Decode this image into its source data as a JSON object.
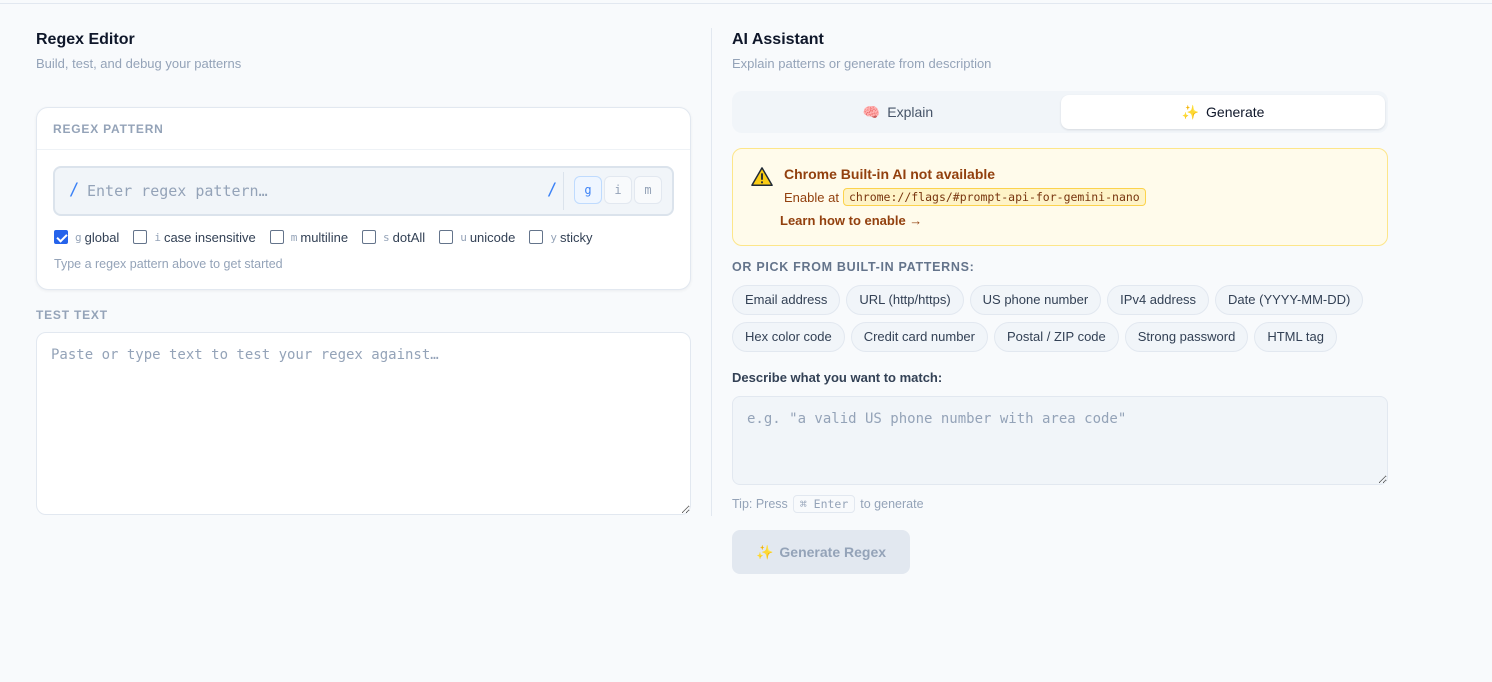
{
  "editor": {
    "title": "Regex Editor",
    "subtitle": "Build, test, and debug your patterns",
    "pattern_card_label": "REGEX PATTERN",
    "pattern_placeholder": "Enter regex pattern…",
    "slash_open": "/",
    "slash_close": "/",
    "active_flag_chips": [
      "g",
      "i",
      "m"
    ],
    "flags": [
      {
        "letter": "g",
        "label": "global",
        "checked": true
      },
      {
        "letter": "i",
        "label": "case insensitive",
        "checked": false
      },
      {
        "letter": "m",
        "label": "multiline",
        "checked": false
      },
      {
        "letter": "s",
        "label": "dotAll",
        "checked": false
      },
      {
        "letter": "u",
        "label": "unicode",
        "checked": false
      },
      {
        "letter": "y",
        "label": "sticky",
        "checked": false
      }
    ],
    "hint": "Type a regex pattern above to get started",
    "test_text_label": "TEST TEXT",
    "test_text_placeholder": "Paste or type text to test your regex against…"
  },
  "assistant": {
    "title": "AI Assistant",
    "subtitle": "Explain patterns or generate from description",
    "tabs": [
      {
        "label": "Explain",
        "icon": "brain-icon",
        "glyph": "🧠",
        "active": false
      },
      {
        "label": "Generate",
        "icon": "sparkles-icon",
        "glyph": "✨",
        "active": true
      }
    ],
    "alert": {
      "title": "Chrome Built-in AI not available",
      "enable_prefix": "Enable at",
      "flag_code": "chrome://flags/#prompt-api-for-gemini-nano",
      "learn_link": "Learn how to enable →",
      "color_bg": "#fffbeb",
      "color_text": "#92400e"
    },
    "pick_label": "OR PICK FROM BUILT-IN PATTERNS:",
    "patterns_row1": [
      "Email address",
      "URL (http/https)",
      "US phone number",
      "IPv4 address",
      "Date (YYYY-MM-DD)"
    ],
    "patterns_row2": [
      "Hex color code",
      "Credit card number",
      "Postal / ZIP code",
      "Strong password",
      "HTML tag"
    ],
    "describe_label": "Describe what you want to match:",
    "describe_placeholder": "e.g. \"a valid US phone number with area code\"",
    "tip_prefix": "Tip: Press",
    "tip_key": "⌘ Enter",
    "tip_suffix": "to generate",
    "generate_button": "Generate Regex",
    "generate_glyph": "✨"
  },
  "colors": {
    "accent": "#3b82f6",
    "checkbox": "#2563eb",
    "muted": "#94a3b8"
  }
}
